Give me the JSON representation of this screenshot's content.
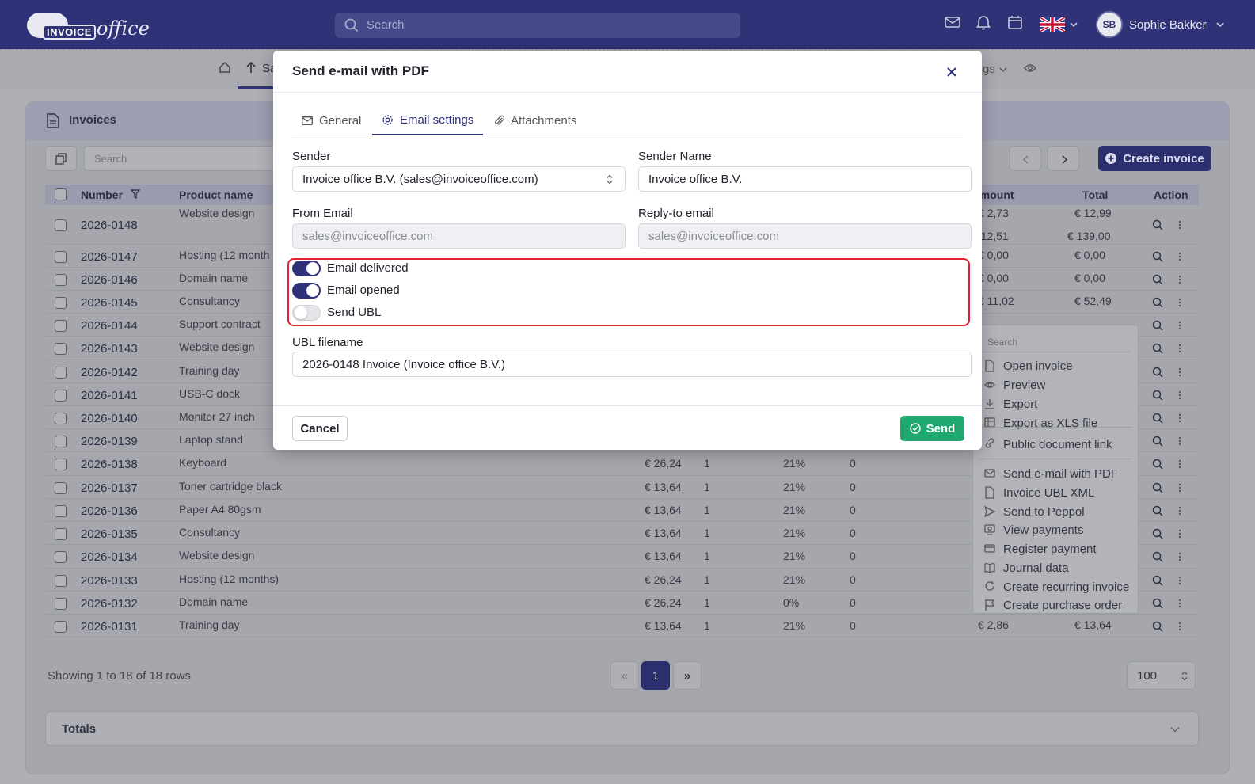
{
  "topbar": {
    "logo_word": "INVOICE",
    "logo_word2": "office",
    "search_placeholder": "Search",
    "user_initials": "SB",
    "user_name": "Sophie Bakker"
  },
  "nav": {
    "visible_left": "Sa",
    "visible_right": "gs"
  },
  "card": {
    "title": "Invoices",
    "search_placeholder": "Search",
    "create_label": "Create invoice"
  },
  "table": {
    "headers": {
      "number": "Number",
      "product": "Product name",
      "amount": "amount",
      "total": "Total",
      "action": "Action"
    },
    "rows": [
      {
        "number": "2026-0148",
        "product": "Website design",
        "price": "",
        "qty": "",
        "vat": "",
        "disc": "",
        "amount": "€ 2,73",
        "total": "€ 12,99",
        "amount2": "€ 12,51",
        "total2": "€ 139,00"
      },
      {
        "number": "2026-0147",
        "product": "Hosting (12 month",
        "price": "",
        "qty": "",
        "vat": "",
        "disc": "",
        "amount": "€ 0,00",
        "total": "€ 0,00"
      },
      {
        "number": "2026-0146",
        "product": "Domain name",
        "price": "",
        "qty": "",
        "vat": "",
        "disc": "",
        "amount": "€ 0,00",
        "total": "€ 0,00"
      },
      {
        "number": "2026-0145",
        "product": "Consultancy",
        "price": "",
        "qty": "",
        "vat": "",
        "disc": "",
        "amount": "€ 11,02",
        "total": "€ 52,49"
      },
      {
        "number": "2026-0144",
        "product": "Support contract",
        "price": "",
        "qty": "",
        "vat": "",
        "disc": "",
        "amount": "",
        "total": ""
      },
      {
        "number": "2026-0143",
        "product": "Website design",
        "price": "",
        "qty": "",
        "vat": "",
        "disc": "",
        "amount": "",
        "total": ""
      },
      {
        "number": "2026-0142",
        "product": "Training day",
        "price": "",
        "qty": "",
        "vat": "",
        "disc": "",
        "amount": "",
        "total": ""
      },
      {
        "number": "2026-0141",
        "product": "USB-C dock",
        "price": "",
        "qty": "",
        "vat": "",
        "disc": "",
        "amount": "",
        "total": ""
      },
      {
        "number": "2026-0140",
        "product": "Monitor 27 inch",
        "price": "",
        "qty": "",
        "vat": "",
        "disc": "",
        "amount": "",
        "total": ""
      },
      {
        "number": "2026-0139",
        "product": "Laptop stand",
        "price": "",
        "qty": "",
        "vat": "",
        "disc": "",
        "amount": "",
        "total": ""
      },
      {
        "number": "2026-0138",
        "product": "Keyboard",
        "price": "€ 26,24",
        "qty": "1",
        "vat": "21%",
        "disc": "0",
        "amount": "",
        "total": ""
      },
      {
        "number": "2026-0137",
        "product": "Toner cartridge black",
        "price": "€ 13,64",
        "qty": "1",
        "vat": "21%",
        "disc": "0",
        "amount": "",
        "total": ""
      },
      {
        "number": "2026-0136",
        "product": "Paper A4 80gsm",
        "price": "€ 13,64",
        "qty": "1",
        "vat": "21%",
        "disc": "0",
        "amount": "",
        "total": ""
      },
      {
        "number": "2026-0135",
        "product": "Consultancy",
        "price": "€ 13,64",
        "qty": "1",
        "vat": "21%",
        "disc": "0",
        "amount": "",
        "total": ""
      },
      {
        "number": "2026-0134",
        "product": "Website design",
        "price": "€ 13,64",
        "qty": "1",
        "vat": "21%",
        "disc": "0",
        "amount": "",
        "total": ""
      },
      {
        "number": "2026-0133",
        "product": "Hosting (12 months)",
        "price": "€ 26,24",
        "qty": "1",
        "vat": "21%",
        "disc": "0",
        "amount": "",
        "total": ""
      },
      {
        "number": "2026-0132",
        "product": "Domain name",
        "price": "€ 26,24",
        "qty": "1",
        "vat": "0%",
        "disc": "0",
        "amount": "",
        "total": ""
      },
      {
        "number": "2026-0131",
        "product": "Training day",
        "price": "€ 13,64",
        "qty": "1",
        "vat": "21%",
        "disc": "0",
        "amount": "€ 2,86",
        "total": "€ 13,64"
      }
    ]
  },
  "footer": {
    "showing": "Showing 1 to 18 of 18 rows",
    "prev": "«",
    "page": "1",
    "next": "»",
    "per_page": "100",
    "totals": "Totals"
  },
  "context_menu": {
    "search_placeholder": "Search",
    "items": [
      {
        "label": "Open invoice",
        "icon": "file-icon"
      },
      {
        "label": "Preview",
        "icon": "eye-icon"
      },
      {
        "label": "Export",
        "icon": "download-icon"
      },
      {
        "label": "Export as XLS file",
        "icon": "table-icon"
      },
      {
        "label": "Public document link",
        "icon": "link-icon"
      },
      {
        "label": "Send e-mail with PDF",
        "icon": "envelope-icon"
      },
      {
        "label": "Invoice UBL XML",
        "icon": "file-icon"
      },
      {
        "label": "Send to Peppol",
        "icon": "send-icon"
      },
      {
        "label": "View payments",
        "icon": "monitor-icon"
      },
      {
        "label": "Register payment",
        "icon": "card-icon"
      },
      {
        "label": "Journal data",
        "icon": "book-icon"
      },
      {
        "label": "Create recurring invoice",
        "icon": "refresh-icon"
      },
      {
        "label": "Create purchase order",
        "icon": "flag-icon"
      }
    ]
  },
  "modal": {
    "title": "Send e-mail with PDF",
    "tabs": [
      "General",
      "Email settings",
      "Attachments"
    ],
    "active_tab": "Email settings",
    "sender_label": "Sender",
    "sender_value": "Invoice office B.V. (sales@invoiceoffice.com)",
    "sender_name_label": "Sender Name",
    "sender_name_value": "Invoice office B.V.",
    "from_email_label": "From Email",
    "from_email_placeholder": "sales@invoiceoffice.com",
    "reply_to_label": "Reply-to email",
    "reply_to_placeholder": "sales@invoiceoffice.com",
    "toggles": [
      {
        "label": "Email delivered",
        "on": true
      },
      {
        "label": "Email opened",
        "on": true
      },
      {
        "label": "Send UBL",
        "on": false
      }
    ],
    "ubl_filename_label": "UBL filename",
    "ubl_filename_value": "2026-0148 Invoice (Invoice office B.V.)",
    "cancel_label": "Cancel",
    "send_label": "Send"
  },
  "colors": {
    "primary": "#2f3277",
    "success": "#1fa870",
    "highlight": "#e1222f"
  }
}
